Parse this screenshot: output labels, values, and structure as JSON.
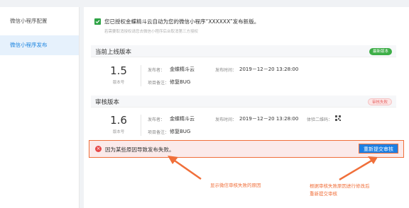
{
  "sidebar": {
    "items": [
      {
        "label": "微信小程序配置",
        "active": false
      },
      {
        "label": "微信小程序发布",
        "active": true
      }
    ]
  },
  "notice": {
    "title": "您已授权金蝶精斗云自动为您的微信小程序“XXXXXX”发布新版。",
    "subtitle": "若需要取消授权请您去微信小程序后台取消第三方授权"
  },
  "current_version": {
    "section_title": "当前上线版本",
    "badge": "最新版本",
    "version_number": "1.5",
    "version_label": "版本号",
    "publisher_label": "发布者：",
    "publisher": "金蝶精斗云",
    "publish_time_label": "发布时间：",
    "publish_time": "2019－12－20 13:28:00",
    "remark_label": "项目备注：",
    "remark": "修复BUG"
  },
  "review_version": {
    "section_title": "审核版本",
    "badge": "审核失败",
    "version_number": "1.6",
    "version_label": "版本号",
    "publisher_label": "发布者：",
    "publisher": "金蝶精斗云",
    "publish_time_label": "发布时间：",
    "publish_time": "2019－12－20 13:28:00",
    "qr_label": "体验二维码：",
    "remark_label": "项目备注：",
    "remark": "修复BUG"
  },
  "failure": {
    "message": "因为某些原因导致发布失败。",
    "resubmit_label": "重新提交审核"
  },
  "annotations": {
    "left": "显示微信审核失败的原因",
    "right_line1": "根据审核失败原因进行修改后",
    "right_line2": "重新提交审核"
  },
  "colors": {
    "accent_blue": "#1c7fe3",
    "success_green": "#3dae47",
    "error_red": "#e74848",
    "annotation_orange": "#f06f3a"
  }
}
